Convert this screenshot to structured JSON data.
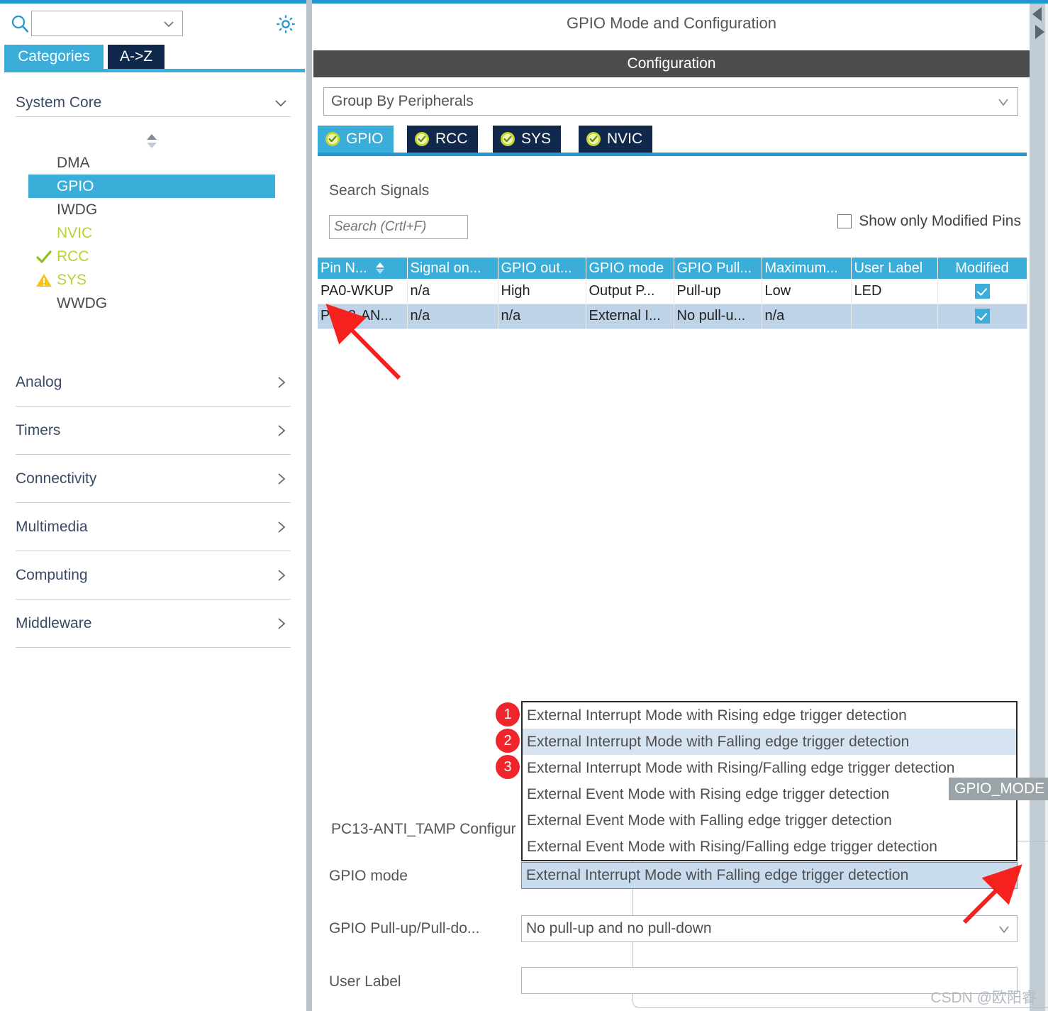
{
  "left_panel": {
    "search": {
      "value": "",
      "placeholder": ""
    },
    "gear_icon": "gear-icon",
    "tabs": [
      {
        "label": "Categories",
        "active": true
      },
      {
        "label": "A->Z",
        "active": false
      }
    ],
    "groups": [
      {
        "label": "System Core",
        "expanded": true
      },
      {
        "label": "Analog",
        "expanded": false
      },
      {
        "label": "Timers",
        "expanded": false
      },
      {
        "label": "Connectivity",
        "expanded": false
      },
      {
        "label": "Multimedia",
        "expanded": false
      },
      {
        "label": "Computing",
        "expanded": false
      },
      {
        "label": "Middleware",
        "expanded": false
      }
    ],
    "peripherals": [
      {
        "label": "DMA",
        "selected": false,
        "status": "none",
        "color": "#4a4a4a"
      },
      {
        "label": "GPIO",
        "selected": true,
        "status": "none",
        "color": "#ffffff"
      },
      {
        "label": "IWDG",
        "selected": false,
        "status": "none",
        "color": "#4a4a4a"
      },
      {
        "label": "NVIC",
        "selected": false,
        "status": "none",
        "color": "#b7d432"
      },
      {
        "label": "RCC",
        "selected": false,
        "status": "check",
        "color": "#b7d432"
      },
      {
        "label": "SYS",
        "selected": false,
        "status": "warning",
        "color": "#b7d432"
      },
      {
        "label": "WWDG",
        "selected": false,
        "status": "none",
        "color": "#4a4a4a"
      }
    ]
  },
  "right_panel": {
    "title": "GPIO Mode and Configuration",
    "configuration_band": "Configuration",
    "group_by": {
      "value": "Group By Peripherals"
    },
    "peripheral_tabs": [
      {
        "label": "GPIO",
        "active": true
      },
      {
        "label": "RCC",
        "active": false
      },
      {
        "label": "SYS",
        "active": false
      },
      {
        "label": "NVIC",
        "active": false
      }
    ],
    "search_signals": {
      "label": "Search Signals",
      "placeholder": "Search (Crtl+F)",
      "value": ""
    },
    "show_only_modified": {
      "label": "Show only Modified Pins",
      "checked": false
    },
    "pins_table": {
      "columns": [
        "Pin N...",
        "Signal on...",
        "GPIO out...",
        "GPIO mode",
        "GPIO Pull...",
        "Maximum...",
        "User Label",
        "Modified"
      ],
      "sort_column": "Pin N...",
      "rows": [
        {
          "selected": false,
          "pin": "PA0-WKUP",
          "signal": "n/a",
          "output": "High",
          "mode": "Output P...",
          "pull": "Pull-up",
          "max": "Low",
          "user_label": "LED",
          "modified": true
        },
        {
          "selected": true,
          "pin": "PC13-AN...",
          "signal": "n/a",
          "output": "n/a",
          "mode": "External I...",
          "pull": "No pull-u...",
          "max": "n/a",
          "user_label": "",
          "modified": true
        }
      ]
    },
    "mode_dropdown": {
      "open": true,
      "options": [
        {
          "label": "External Interrupt Mode with Rising edge trigger detection",
          "highlighted": false
        },
        {
          "label": "External Interrupt Mode with Falling edge trigger detection",
          "highlighted": true
        },
        {
          "label": "External Interrupt Mode with Rising/Falling edge trigger detection",
          "highlighted": false
        },
        {
          "label": "External Event Mode with Rising edge trigger detection",
          "highlighted": false
        },
        {
          "label": "External Event Mode with Falling edge trigger detection",
          "highlighted": false
        },
        {
          "label": "External Event Mode with Rising/Falling edge trigger detection",
          "highlighted": false
        }
      ]
    },
    "tooltip": {
      "text": "GPIO_MODE"
    },
    "pin_config": {
      "title": "PC13-ANTI_TAMP Configur",
      "fields": [
        {
          "label": "GPIO mode",
          "value": "External Interrupt Mode with Falling edge trigger detection",
          "type": "combo"
        },
        {
          "label": "GPIO Pull-up/Pull-do...",
          "value": "No pull-up and no pull-down",
          "type": "combo"
        },
        {
          "label": "User Label",
          "value": "",
          "type": "input"
        }
      ]
    }
  },
  "annotations": {
    "badges": [
      "1",
      "2",
      "3"
    ],
    "arrow_color": "#f5211e"
  },
  "watermark": "CSDN @欧阳睿",
  "colors": {
    "accent_blue": "#3aadd9",
    "dark_navy": "#10284b",
    "band_gray": "#4d4d4d",
    "row_selected": "#bed3e8",
    "badge_red": "#f0252b",
    "status_green": "#b7d432",
    "warn_yellow": "#f6c319"
  }
}
